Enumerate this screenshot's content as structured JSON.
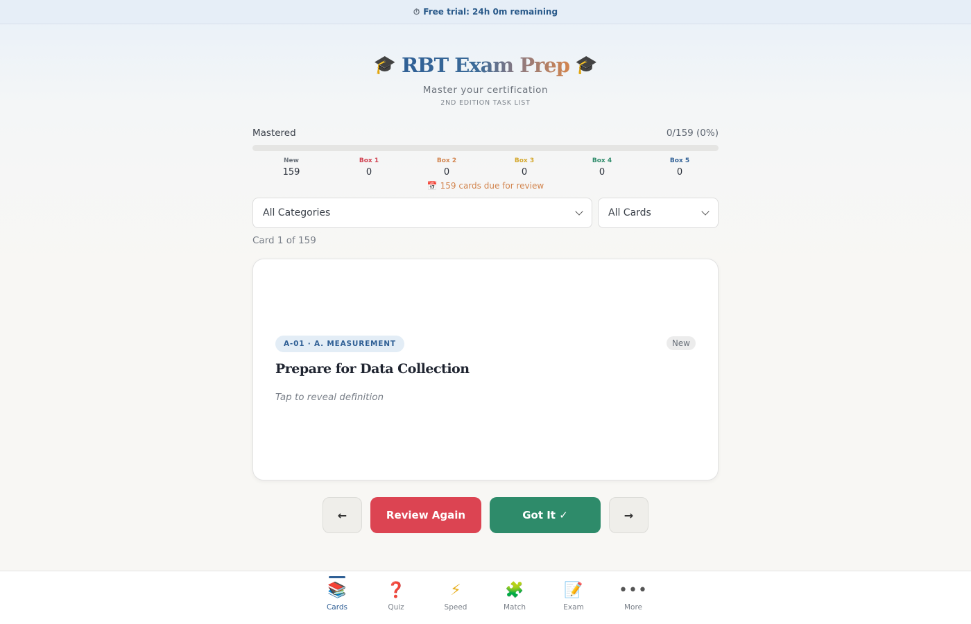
{
  "trial": {
    "icon": "stopwatch-icon",
    "text": "Free trial: 24h 0m remaining"
  },
  "header": {
    "title": "RBT Exam Prep",
    "subtitle": "Master your certification",
    "edition": "2ND EDITION TASK LIST"
  },
  "mastery": {
    "label": "Mastered",
    "count": "0/159 (0%)",
    "progress_fraction": 0
  },
  "boxes": [
    {
      "label": "New",
      "value": "159",
      "color": "#6c737c"
    },
    {
      "label": "Box 1",
      "value": "0",
      "color": "#d04050"
    },
    {
      "label": "Box 2",
      "value": "0",
      "color": "#d2844e"
    },
    {
      "label": "Box 3",
      "value": "0",
      "color": "#d4a72c"
    },
    {
      "label": "Box 4",
      "value": "0",
      "color": "#2e8b6a"
    },
    {
      "label": "Box 5",
      "value": "0",
      "color": "#2f5f95"
    }
  ],
  "due": {
    "icon": "calendar-icon",
    "text": "159 cards due for review"
  },
  "filters": {
    "category": "All Categories",
    "cards": "All Cards"
  },
  "card_counter": "Card 1 of 159",
  "card": {
    "tag": "A-01 · A. MEASUREMENT",
    "status": "New",
    "term": "Prepare for Data Collection",
    "hint": "Tap to reveal definition"
  },
  "actions": {
    "prev": "←",
    "review": "Review Again",
    "got_it": "Got It ✓",
    "next": "→"
  },
  "nav": [
    {
      "label": "Cards",
      "icon": "books-icon",
      "glyph": "📚",
      "active": true
    },
    {
      "label": "Quiz",
      "icon": "question-icon",
      "glyph": "❓",
      "active": false
    },
    {
      "label": "Speed",
      "icon": "lightning-icon",
      "glyph": "⚡",
      "active": false
    },
    {
      "label": "Match",
      "icon": "puzzle-icon",
      "glyph": "🧩",
      "active": false
    },
    {
      "label": "Exam",
      "icon": "memo-icon",
      "glyph": "📝",
      "active": false
    },
    {
      "label": "More",
      "icon": "more-icon",
      "glyph": "•••",
      "active": false
    }
  ],
  "colors": {
    "primary": "#2f5f95",
    "danger": "#dc4452",
    "success": "#2e8b6a",
    "accent": "#d2844e"
  }
}
